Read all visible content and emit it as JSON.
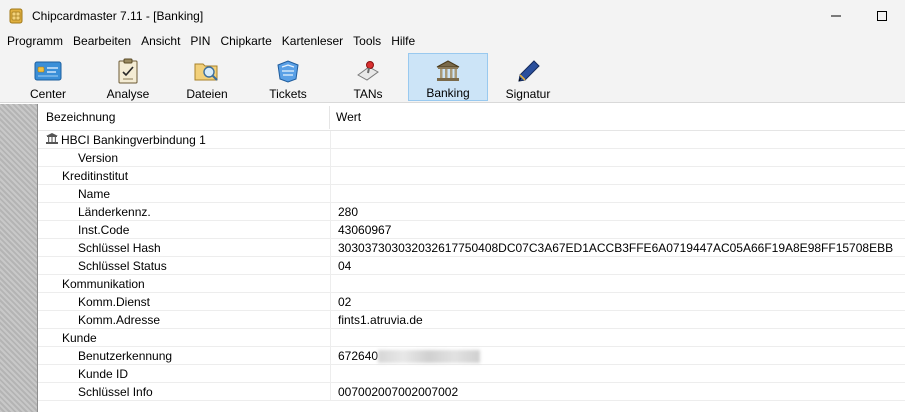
{
  "window": {
    "title": "Chipcardmaster 7.11 - [Banking]"
  },
  "menu": [
    "Programm",
    "Bearbeiten",
    "Ansicht",
    "PIN",
    "Chipkarte",
    "Kartenleser",
    "Tools",
    "Hilfe"
  ],
  "toolbar": [
    {
      "label": "Center",
      "icon": "card-icon"
    },
    {
      "label": "Analyse",
      "icon": "clipboard-icon"
    },
    {
      "label": "Dateien",
      "icon": "folder-search-icon"
    },
    {
      "label": "Tickets",
      "icon": "ticket-icon"
    },
    {
      "label": "TANs",
      "icon": "stamp-icon"
    },
    {
      "label": "Banking",
      "icon": "bank-icon",
      "active": true
    },
    {
      "label": "Signatur",
      "icon": "pen-icon"
    }
  ],
  "table": {
    "columns": [
      "Bezeichnung",
      "Wert"
    ],
    "rows": [
      {
        "label": "HBCI Bankingverbindung 1",
        "value": "",
        "level": 0,
        "icon": "bank-icon"
      },
      {
        "label": "Version",
        "value": "",
        "level": 2
      },
      {
        "label": "Kreditinstitut",
        "value": "",
        "level": 1
      },
      {
        "label": "Name",
        "value": "",
        "level": 2
      },
      {
        "label": "Länderkennz.",
        "value": "280",
        "level": 2
      },
      {
        "label": "Inst.Code",
        "value": "43060967",
        "level": 2
      },
      {
        "label": "Schlüssel Hash",
        "value": "303037303032032617750408DC07C3A67ED1ACCB3FFE6A0719447AC05A66F19A8E98FF15708EBB",
        "level": 2
      },
      {
        "label": "Schlüssel Status",
        "value": "04",
        "level": 2
      },
      {
        "label": "Kommunikation",
        "value": "",
        "level": 1
      },
      {
        "label": "Komm.Dienst",
        "value": "02",
        "level": 2
      },
      {
        "label": "Komm.Adresse",
        "value": "fints1.atruvia.de",
        "level": 2
      },
      {
        "label": "Kunde",
        "value": "",
        "level": 1
      },
      {
        "label": "Benutzerkennung",
        "value": "672640",
        "level": 2,
        "blurred": true
      },
      {
        "label": "Kunde ID",
        "value": "",
        "level": 2
      },
      {
        "label": "Schlüssel Info",
        "value": "007002007002007002",
        "level": 2
      }
    ]
  }
}
